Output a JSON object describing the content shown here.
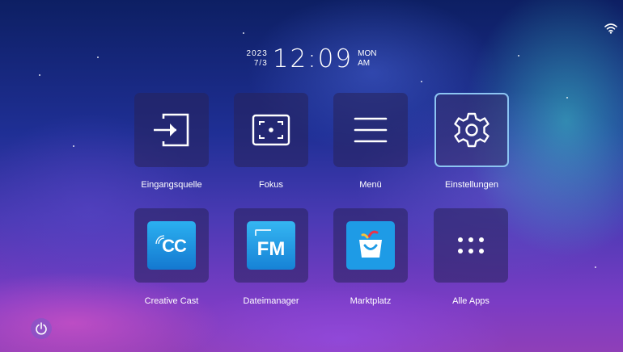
{
  "clock": {
    "year": "2023",
    "date": "7/3",
    "time": "12:09",
    "weekday": "MON",
    "ampm": "AM"
  },
  "status": {
    "wifi_icon": "wifi-icon"
  },
  "tiles": [
    {
      "label": "Eingangsquelle",
      "icon": "input-source-icon"
    },
    {
      "label": "Fokus",
      "icon": "focus-icon"
    },
    {
      "label": "Menü",
      "icon": "menu-icon"
    },
    {
      "label": "Einstellungen",
      "icon": "gear-icon",
      "selected": true
    },
    {
      "label": "Creative Cast",
      "icon": "creative-cast-icon",
      "icon_text": "CC"
    },
    {
      "label": "Dateimanager",
      "icon": "file-manager-icon",
      "icon_text": "FM"
    },
    {
      "label": "Marktplatz",
      "icon": "marketplace-icon"
    },
    {
      "label": "Alle Apps",
      "icon": "all-apps-icon"
    }
  ],
  "power": {
    "icon": "power-icon"
  },
  "colors": {
    "selected_border": "#8cc4f2",
    "app_blue": "#1e9be6"
  }
}
